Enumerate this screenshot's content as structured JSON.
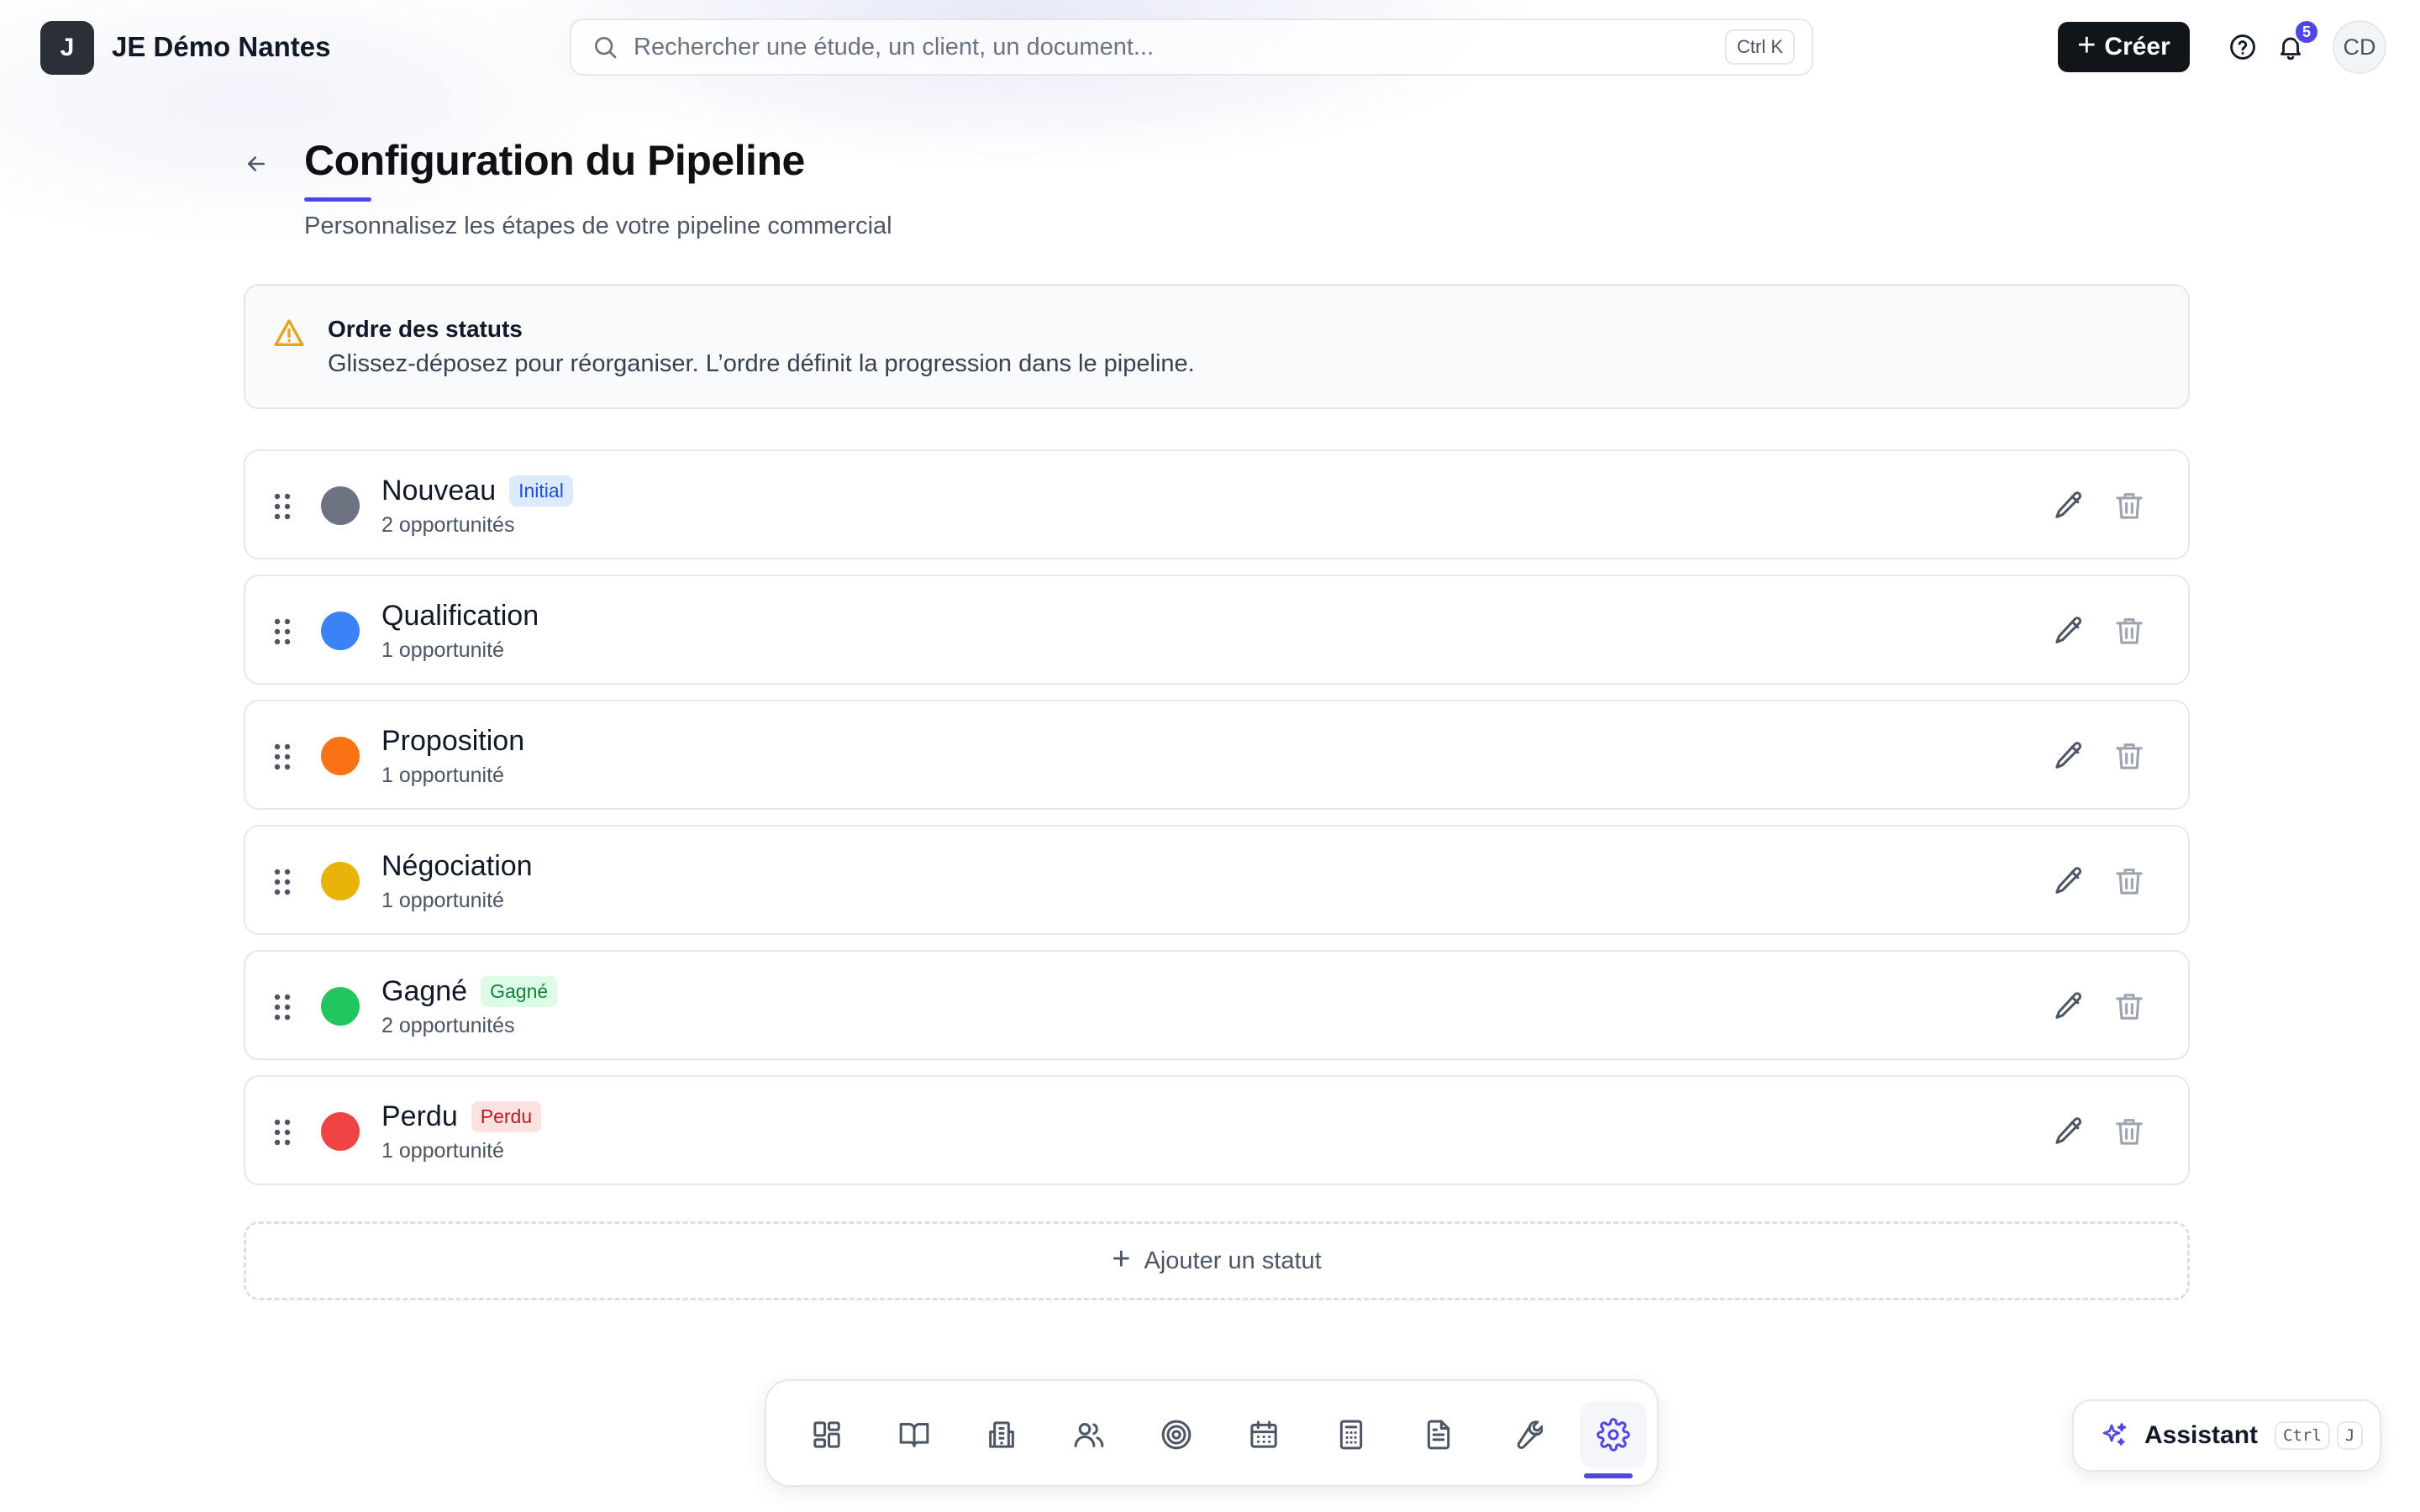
{
  "header": {
    "logo_letter": "J",
    "app_name": "JE Démo Nantes",
    "search_placeholder": "Rechercher une étude, un client, un document...",
    "search_shortcut": "Ctrl K",
    "create_label": "Créer",
    "notification_count": "5",
    "avatar_initials": "CD"
  },
  "page": {
    "title": "Configuration du Pipeline",
    "subtitle": "Personnalisez les étapes de votre pipeline commercial"
  },
  "alert": {
    "title": "Ordre des statuts",
    "text": "Glissez-déposez pour réorganiser. L’ordre définit la progression dans le pipeline.",
    "icon": "warning-triangle-icon",
    "color": "#e8a317"
  },
  "statuses": [
    {
      "name": "Nouveau",
      "count": "2 opportunités",
      "color": "#6b7280",
      "badge": "Initial",
      "badge_bg": "#dbeafe",
      "badge_fg": "#1d4ed8"
    },
    {
      "name": "Qualification",
      "count": "1 opportunité",
      "color": "#3b82f6",
      "badge": "",
      "badge_bg": "",
      "badge_fg": ""
    },
    {
      "name": "Proposition",
      "count": "1 opportunité",
      "color": "#f97316",
      "badge": "",
      "badge_bg": "",
      "badge_fg": ""
    },
    {
      "name": "Négociation",
      "count": "1 opportunité",
      "color": "#eab308",
      "badge": "",
      "badge_bg": "",
      "badge_fg": ""
    },
    {
      "name": "Gagné",
      "count": "2 opportunités",
      "color": "#22c55e",
      "badge": "Gagné",
      "badge_bg": "#dcfce7",
      "badge_fg": "#15803d"
    },
    {
      "name": "Perdu",
      "count": "1 opportunité",
      "color": "#ef4444",
      "badge": "Perdu",
      "badge_bg": "#fee2e2",
      "badge_fg": "#b91c1c"
    }
  ],
  "add_status_label": "Ajouter un statut",
  "dock": {
    "items": [
      "dashboard-icon",
      "book-icon",
      "building-icon",
      "users-icon",
      "target-icon",
      "calendar-icon",
      "calculator-icon",
      "document-icon",
      "wrench-icon",
      "settings-icon"
    ],
    "active": "settings-icon",
    "accent": "#4f46e5"
  },
  "assistant": {
    "label": "Assistant",
    "shortcut_keys": [
      "Ctrl",
      "J"
    ]
  }
}
